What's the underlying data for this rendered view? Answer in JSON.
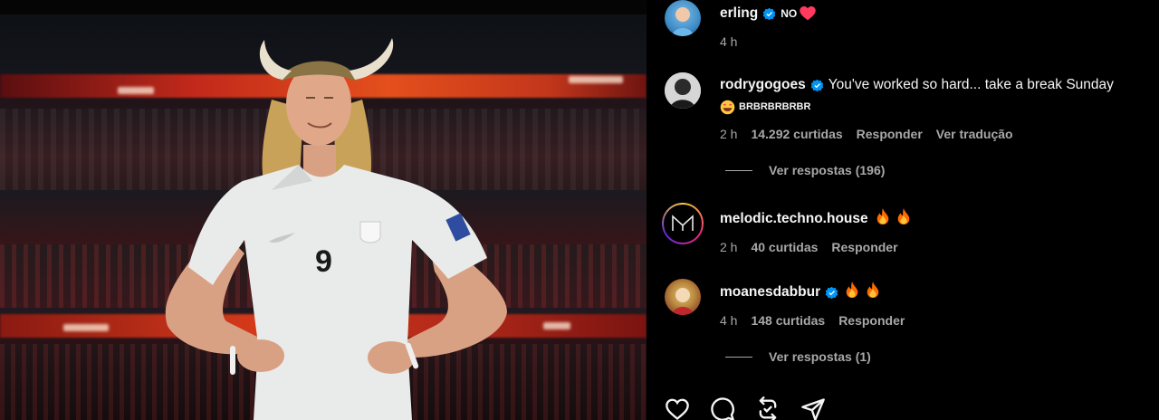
{
  "post": {
    "photo_alt": "Player in white jersey number 9 wearing horned viking helmet in stadium",
    "jersey_number": "9"
  },
  "comments": [
    {
      "username": "erling",
      "verified": true,
      "text": "NO",
      "text_emoji": "heart",
      "time": "4 h",
      "likes": "",
      "reply_label": "",
      "translate_label": ""
    },
    {
      "username": "rodrygogoes",
      "verified": true,
      "text": "You've worked so hard... take a break Sunday",
      "text2": "BRBRBRBRBR",
      "text2_emoji": "grinning-heart-eyes",
      "time": "2 h",
      "likes": "14.292 curtidas",
      "reply_label": "Responder",
      "translate_label": "Ver tradução"
    },
    {
      "username": "melodic.techno.house",
      "verified": false,
      "text_emoji": "fire-fire",
      "time": "2 h",
      "likes": "40 curtidas",
      "reply_label": "Responder"
    },
    {
      "username": "moanesdabbur",
      "verified": true,
      "text_emoji": "fire-fire",
      "time": "4 h",
      "likes": "148 curtidas",
      "reply_label": "Responder"
    }
  ],
  "replies": [
    {
      "label": "Ver respostas (196)"
    },
    {
      "label": "Ver respostas (1)"
    }
  ],
  "actions": [
    "heart-icon",
    "comment-icon",
    "repost-icon",
    "share-icon"
  ],
  "colors": {
    "background": "#000000",
    "text": "#f5f5f5",
    "muted": "#a8a8a8",
    "verified": "#0095f6",
    "heart": "#ff3040"
  }
}
